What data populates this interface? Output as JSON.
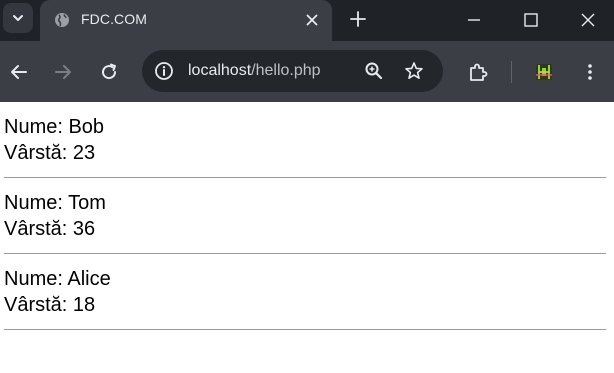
{
  "browser": {
    "tab": {
      "title": "FDC.COM"
    },
    "address_bar": {
      "host": "localhost",
      "path": "/hello.php"
    }
  },
  "page": {
    "records": [
      {
        "name_label": "Nume: Bob",
        "age_label": "Vârstă: 23"
      },
      {
        "name_label": "Nume: Tom",
        "age_label": "Vârstă: 36"
      },
      {
        "name_label": "Nume: Alice",
        "age_label": "Vârstă: 18"
      }
    ]
  },
  "colors": {
    "tabstrip_bg": "#1f2328",
    "toolbar_bg": "#3b3f45",
    "omnibox_bg": "#23262b",
    "extension_accent": "#a6e22e"
  },
  "icons": [
    "chevron-down-icon",
    "globe-icon",
    "close-icon",
    "plus-icon",
    "minimize-icon",
    "maximize-icon",
    "window-close-icon",
    "back-arrow-icon",
    "forward-arrow-icon",
    "reload-icon",
    "info-icon",
    "zoom-icon",
    "star-icon",
    "puzzle-icon",
    "extension-icon",
    "kebab-menu-icon"
  ]
}
